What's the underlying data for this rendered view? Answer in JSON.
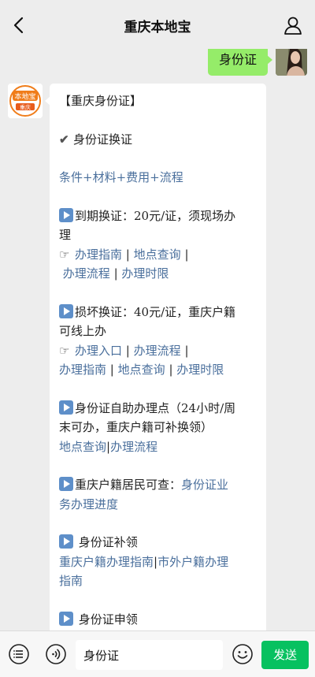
{
  "header": {
    "title": "重庆本地宝",
    "back_icon": "chevron-left-icon",
    "profile_icon": "person-icon"
  },
  "outgoing_message": {
    "text": "身份证"
  },
  "incoming_message": {
    "avatar_logo_text": "本地宝",
    "avatar_logo_sub": "重庆",
    "heading": "【重庆身份证】",
    "section1_title": "身份证换证",
    "section1_link": "条件+材料+费用+流程",
    "expire_line1": "到期换证：20元/证，须现场办",
    "expire_line2": "理",
    "expire_links": [
      "办理指南",
      "地点查询",
      "办理流程",
      "办理时限"
    ],
    "damage_line1": "损坏换证：40元/证，重庆户籍",
    "damage_line2": "可线上办",
    "damage_links": [
      "办理入口",
      "办理流程",
      "办理指南",
      "地点查询",
      "办理时限"
    ],
    "self_line1": "身份证自助办理点（24小时/周",
    "self_line2": "末可办，重庆户籍可补换领）",
    "self_links": [
      "地点查询",
      "办理流程"
    ],
    "progress_prefix": "重庆户籍居民可查：",
    "progress_link_a": "身份证业",
    "progress_link_b": "务办理进度",
    "reissue_title": "身份证补领",
    "reissue_link_a": "重庆户籍办理指南",
    "reissue_link_b": "市外户籍办理",
    "reissue_link_c": "指南",
    "apply_title": "身份证申领",
    "separator": "|"
  },
  "input_bar": {
    "value": "身份证",
    "send_label": "发送",
    "voice_icon": "voice-icon",
    "menu_icon": "menu-icon",
    "emoji_icon": "emoji-icon"
  },
  "colors": {
    "send_green": "#07c160",
    "bubble_green": "#95ec69",
    "link_blue": "#4a6f9c"
  }
}
